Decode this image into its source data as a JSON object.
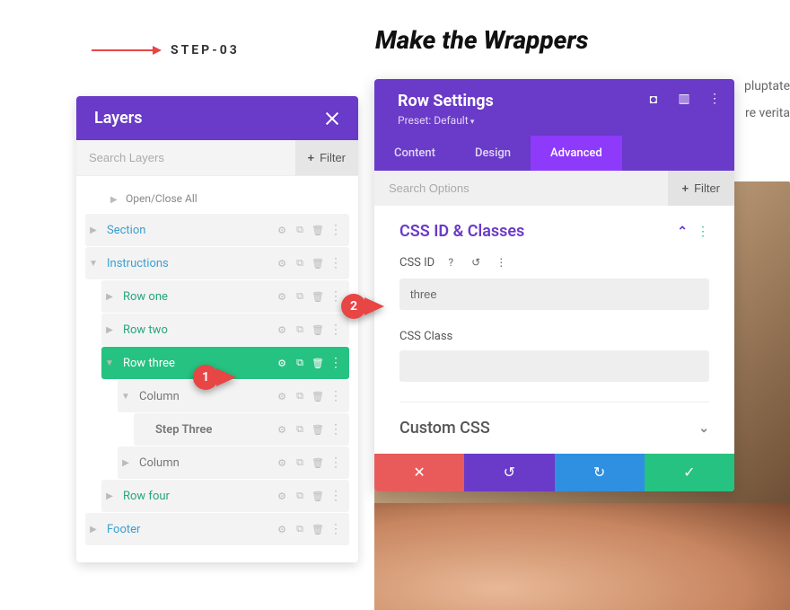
{
  "step": {
    "label": "STEP-03"
  },
  "heading": "Make the Wrappers",
  "lorem": {
    "l1": "pluptate",
    "l2": "re verita"
  },
  "layers": {
    "title": "Layers",
    "search_placeholder": "Search Layers",
    "filter_label": "Filter",
    "open_close": "Open/Close All",
    "items": [
      {
        "label": "Section",
        "style": "blue"
      },
      {
        "label": "Instructions",
        "style": "blue"
      },
      {
        "label": "Row one",
        "style": "teal"
      },
      {
        "label": "Row two",
        "style": "teal"
      },
      {
        "label": "Row three",
        "style": "teal",
        "selected": true
      },
      {
        "label": "Column",
        "style": "plain"
      },
      {
        "label": "Step Three",
        "style": "bold"
      },
      {
        "label": "Column",
        "style": "plain"
      },
      {
        "label": "Row four",
        "style": "teal"
      },
      {
        "label": "Footer",
        "style": "blue"
      }
    ]
  },
  "panel": {
    "title": "Row Settings",
    "preset": "Preset: Default",
    "tabs": [
      "Content",
      "Design",
      "Advanced"
    ],
    "search_placeholder": "Search Options",
    "filter_label": "Filter",
    "section1_title": "CSS ID & Classes",
    "cssid_label": "CSS ID",
    "cssid_value": "three",
    "cssclass_label": "CSS Class",
    "cssclass_value": "",
    "section2_title": "Custom CSS"
  },
  "callouts": {
    "c1": "1",
    "c2": "2"
  }
}
